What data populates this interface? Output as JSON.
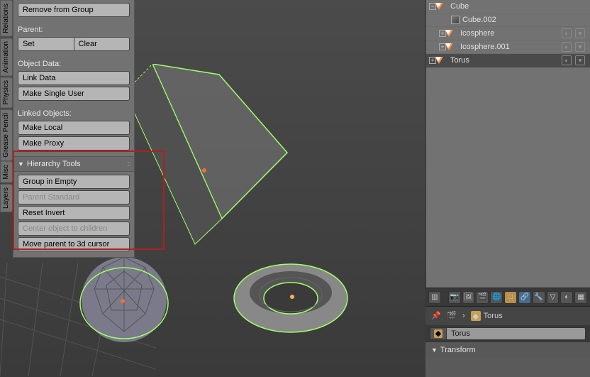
{
  "viewport": {
    "tabs": [
      "Relations",
      "Animation",
      "Physics",
      "Grease Pencil",
      "Misc",
      "Layers"
    ],
    "tools": {
      "remove_from_group": "Remove from Group",
      "parent_label": "Parent:",
      "parent_set": "Set",
      "parent_clear": "Clear",
      "objectdata_label": "Object Data:",
      "link_data": "Link Data",
      "make_single_user": "Make Single User",
      "linkedobj_label": "Linked Objects:",
      "make_local": "Make Local",
      "make_proxy": "Make Proxy"
    },
    "hierarchy": {
      "panel_title": "Hierarchy Tools",
      "group_in_empty": "Group in Empty",
      "parent_standard": "Parent Standard",
      "reset_invert": "Reset Invert",
      "center_children": "Center object to children",
      "move_parent_cursor": "Move parent to 3d cursor"
    }
  },
  "outliner": {
    "items": [
      {
        "name": "Cube",
        "icon": "tri"
      },
      {
        "name": "Cube.002",
        "icon": "mesh"
      },
      {
        "name": "Icosphere",
        "icon": "tri"
      },
      {
        "name": "Icosphere.001",
        "icon": "tri"
      },
      {
        "name": "Torus",
        "icon": "tri"
      }
    ]
  },
  "properties": {
    "context_object": "Torus",
    "object_name": "Torus",
    "transform_label": "Transform"
  }
}
